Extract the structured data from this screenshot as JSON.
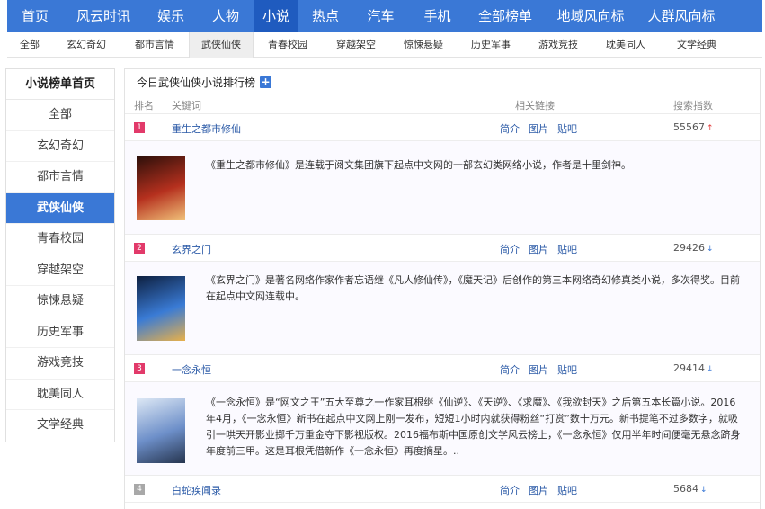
{
  "topnav": [
    {
      "label": "首页",
      "w": 62
    },
    {
      "label": "风云时讯",
      "w": 90
    },
    {
      "label": "娱乐",
      "w": 60
    },
    {
      "label": "人物",
      "w": 62
    },
    {
      "label": "小说",
      "w": 50,
      "active": true
    },
    {
      "label": "热点",
      "w": 60
    },
    {
      "label": "汽车",
      "w": 63
    },
    {
      "label": "手机",
      "w": 63
    },
    {
      "label": "全部榜单",
      "w": 88
    },
    {
      "label": "地域风向标",
      "w": 102
    },
    {
      "label": "人群风向标",
      "w": 100
    }
  ],
  "subnav": [
    "全部",
    "玄幻奇幻",
    "都市言情",
    "武侠仙侠",
    "青春校园",
    "穿越架空",
    "惊悚悬疑",
    "历史军事",
    "游戏竞技",
    "耽美同人",
    "文学经典"
  ],
  "subnav_active": 3,
  "sidebar": {
    "title": "小说榜单首页",
    "items": [
      "全部",
      "玄幻奇幻",
      "都市言情",
      "武侠仙侠",
      "青春校园",
      "穿越架空",
      "惊悚悬疑",
      "历史军事",
      "游戏竞技",
      "耽美同人",
      "文学经典"
    ],
    "active": 3
  },
  "main": {
    "title": "今日武侠仙侠小说排行榜",
    "columns": {
      "rank": "排名",
      "keyword": "关键词",
      "links": "相关链接",
      "score": "搜索指数"
    },
    "link_labels": [
      "简介",
      "图片",
      "贴吧"
    ],
    "rows": [
      {
        "rank": "1",
        "keyword": "重生之都市修仙",
        "score": "55567",
        "trend": "up",
        "desc": "《重生之都市修仙》是连载于阅文集团旗下起点中文网的一部玄幻类网络小说，作者是十里剑神。",
        "cover_colors": [
          "#2a0f0a",
          "#b5301e",
          "#f1c27a"
        ]
      },
      {
        "rank": "2",
        "keyword": "玄界之门",
        "score": "29426",
        "trend": "down",
        "desc": "《玄界之门》是著名网络作家作者忘语继《凡人修仙传》，《魔天记》后创作的第三本网络奇幻修真类小说，多次得奖。目前在起点中文网连载中。",
        "cover_colors": [
          "#0d1f3f",
          "#3a7bd5",
          "#e8b04a"
        ]
      },
      {
        "rank": "3",
        "keyword": "一念永恒",
        "score": "29414",
        "trend": "down",
        "desc": "《一念永恒》是“网文之王”五大至尊之一作家耳根继《仙逆》、《天逆》、《求魔》、《我欲封天》之后第五本长篇小说。2016年4月，《一念永恒》新书在起点中文网上刚一发布，短短1小时内就获得粉丝“打赏”数十万元。新书提笔不过多数字，就吸引一哄天开影业掷千万重金夺下影视版权。2016福布斯中国原创文学风云榜上，《一念永恒》仅用半年时间便毫无悬念跻身年度前三甲。这是耳根凭借新作《一念永恒》再度摘星。..",
        "cover_colors": [
          "#dde8f5",
          "#6d8fc9",
          "#26354f"
        ]
      },
      {
        "rank": "4",
        "keyword": "白蛇疾闻录",
        "score": "5684",
        "trend": "down",
        "desc": "",
        "cover_colors": []
      }
    ]
  }
}
